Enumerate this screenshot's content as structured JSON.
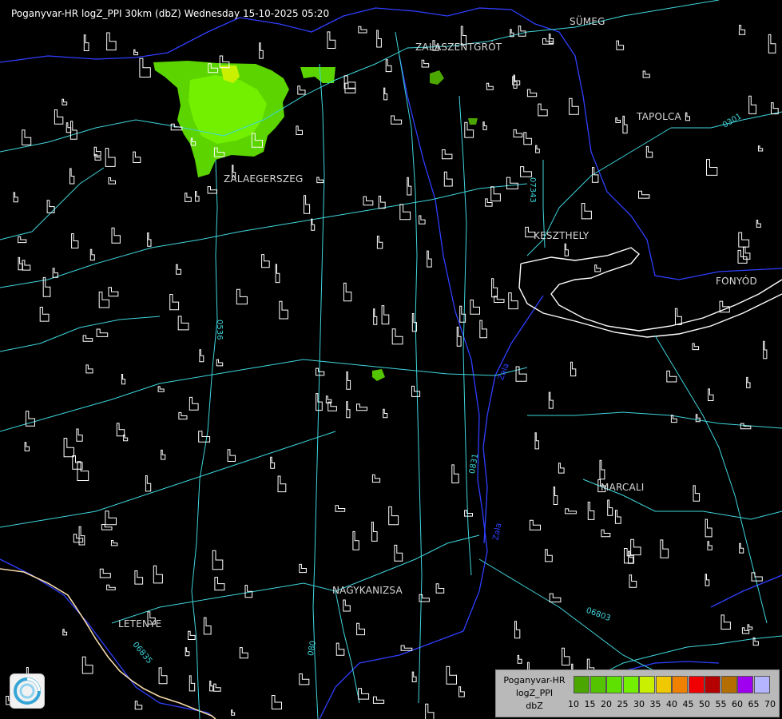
{
  "title": "Poganyvar-HR logZ_PPI 30km (dbZ) Wednesday 15-10-2025 05:20",
  "cities": [
    {
      "name": "SÜMEG"
    },
    {
      "name": "ZALASZENTGRÓT"
    },
    {
      "name": "TAPOLCA"
    },
    {
      "name": "ZALAEGERSZEG"
    },
    {
      "name": "KESZTHELY"
    },
    {
      "name": "FONYÓD"
    },
    {
      "name": "MARCALI"
    },
    {
      "name": "NAGYKANIZSA"
    },
    {
      "name": "LETENYE"
    }
  ],
  "roads": [
    {
      "label": "07343"
    },
    {
      "label": "0301"
    },
    {
      "label": "0536"
    },
    {
      "label": "0831"
    },
    {
      "label": "06803"
    },
    {
      "label": "06835"
    },
    {
      "label": "080"
    }
  ],
  "waters": [
    {
      "label": "Zala"
    },
    {
      "label": "Zala"
    }
  ],
  "colors": {
    "background": "#000000",
    "roads": "#3fd6dd",
    "settlements": "#ffffff",
    "rivers": "#2f3fff",
    "border": "#f5d9a8"
  },
  "legend": {
    "name_lines": [
      "Poganyvar-HR",
      "logZ_PPI",
      "dbZ"
    ],
    "ticks": [
      "10",
      "15",
      "20",
      "25",
      "30",
      "35",
      "40",
      "45",
      "50",
      "55",
      "60",
      "65",
      "70"
    ],
    "colors": [
      "#4ca600",
      "#55c400",
      "#5ee000",
      "#72f000",
      "#c8f000",
      "#f0c800",
      "#f08000",
      "#f00000",
      "#b40000",
      "#b46e00",
      "#a000f0",
      "#b4b4ff"
    ]
  },
  "logo": {
    "icon": "weather-service-logo-icon"
  }
}
